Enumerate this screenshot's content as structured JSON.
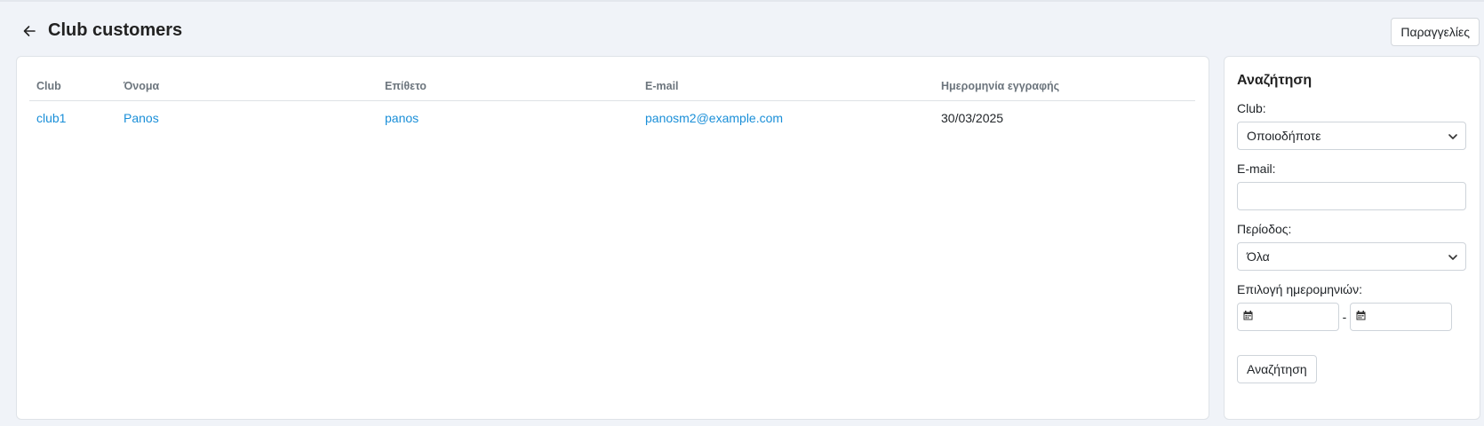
{
  "header": {
    "title": "Club customers",
    "orders_button": "Παραγγελίες"
  },
  "table": {
    "columns": [
      "Club",
      "Όνομα",
      "Επίθετο",
      "E-mail",
      "Ημερομηνία εγγραφής"
    ],
    "rows": [
      {
        "club": "club1",
        "first_name": "Panos",
        "last_name": "panos",
        "email": "panosm2@example.com",
        "registered": "30/03/2025"
      }
    ]
  },
  "filters": {
    "title": "Αναζήτηση",
    "club_label": "Club:",
    "club_value": "Οποιοδήποτε",
    "email_label": "E-mail:",
    "email_value": "",
    "period_label": "Περίοδος:",
    "period_value": "Όλα",
    "dates_label": "Επιλογή ημερομηνιών:",
    "date_separator": "-",
    "search_button": "Αναζήτηση"
  },
  "colors": {
    "background": "#f0f3f8",
    "link": "#1a8fd8"
  }
}
